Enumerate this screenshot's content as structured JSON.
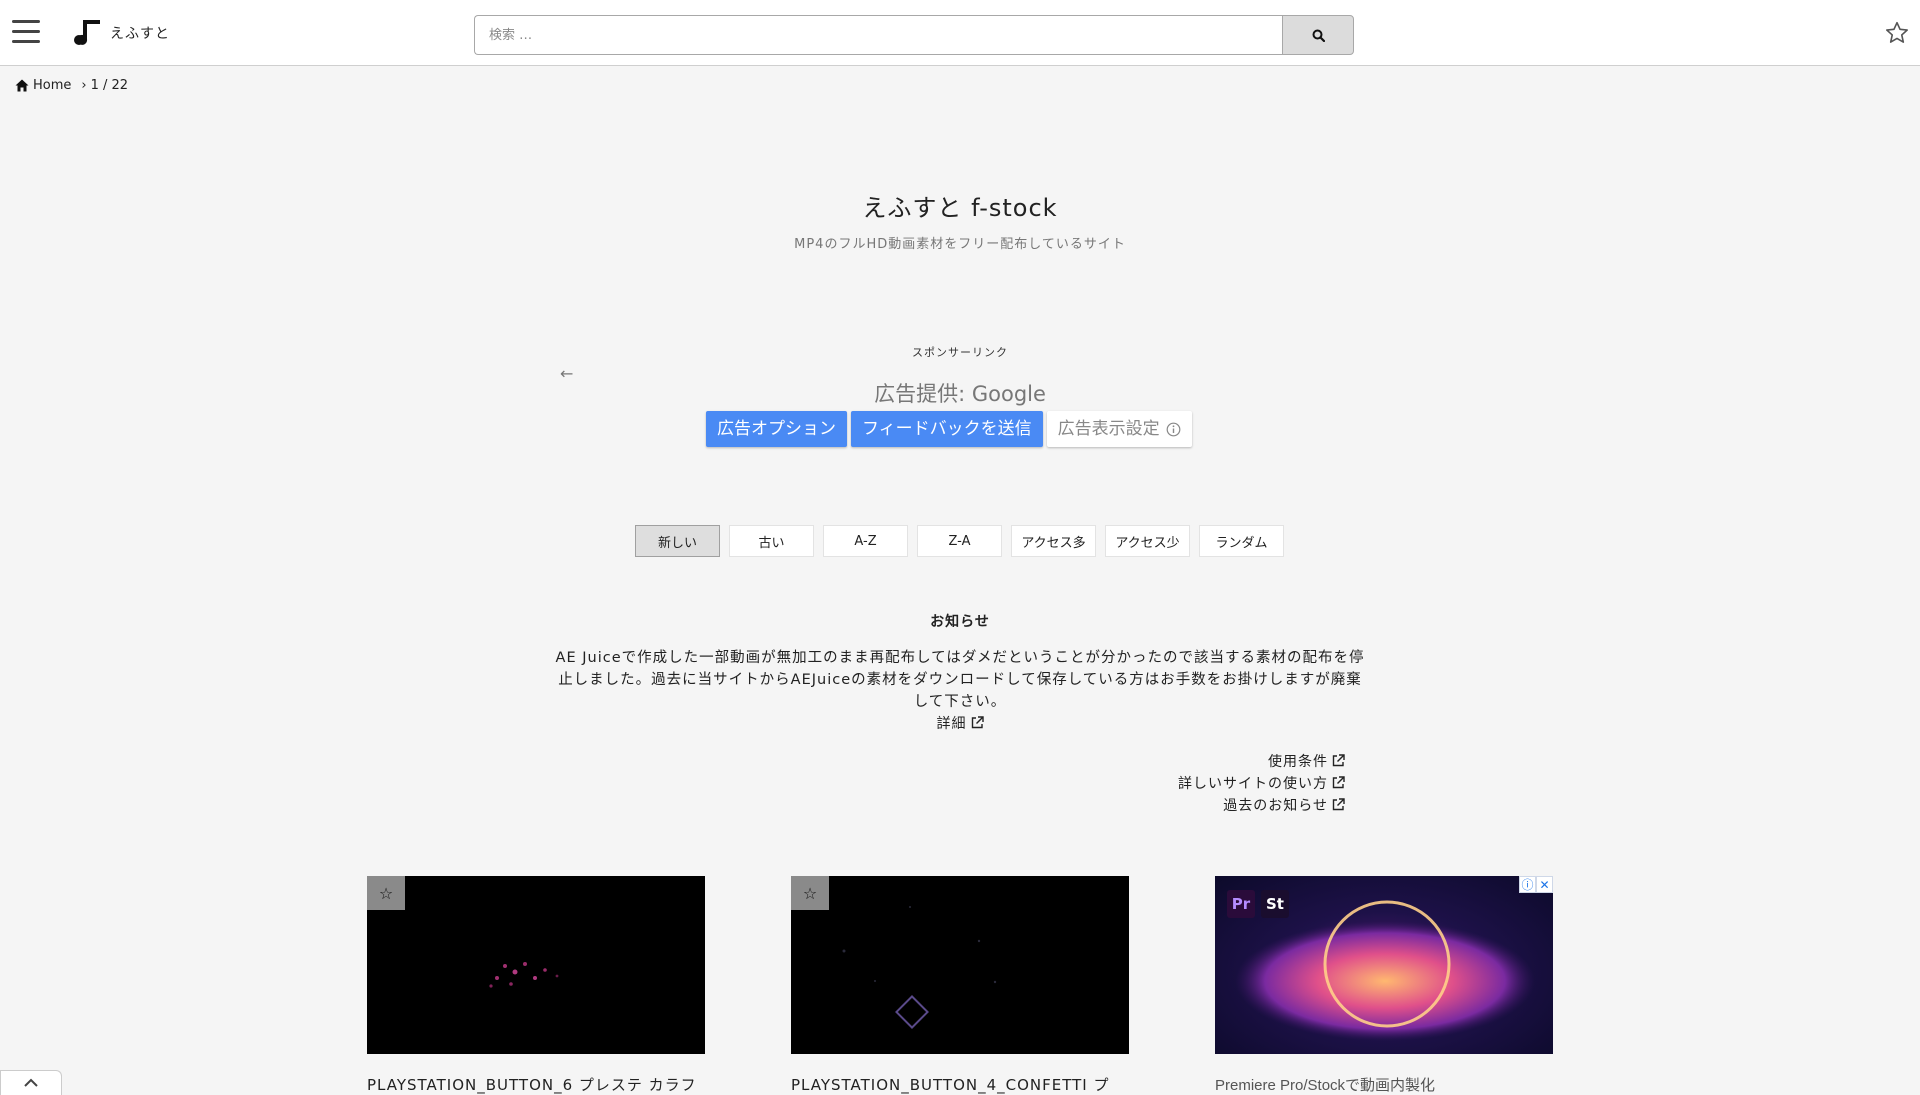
{
  "header": {
    "logo_text": "えふすと",
    "search_placeholder": "検索 …"
  },
  "breadcrumb": {
    "home": "Home",
    "sep": "›",
    "page": "1 / 22"
  },
  "site": {
    "title": "えふすと f-stock",
    "subtitle": "MP4のフルHD動画素材をフリー配布しているサイト"
  },
  "ad": {
    "sponsor_label": "スポンサーリンク",
    "provider": "広告提供: Google",
    "options": "広告オプション",
    "feedback": "フィードバックを送信",
    "settings": "広告表示設定"
  },
  "sorts": [
    "新しい",
    "古い",
    "A-Z",
    "Z-A",
    "アクセス多",
    "アクセス少",
    "ランダム"
  ],
  "sort_active": "新しい",
  "notice": {
    "title": "お知らせ",
    "body": "AE Juiceで作成した一部動画が無加工のまま再配布してはダメだということが分かったので該当する素材の配布を停止しました。過去に当サイトからAEJuiceの素材をダウンロードして保存している方はお手数をお掛けしますが廃棄して下さい。",
    "detail": "詳細"
  },
  "links": {
    "terms": "使用条件",
    "howto": "詳しいサイトの使い方",
    "past": "過去のお知らせ"
  },
  "cards": [
    {
      "title": "PLAYSTATION_BUTTON_6 プレステ カラフ",
      "fav_icon": "☆"
    },
    {
      "title": "PLAYSTATION_BUTTON_4_CONFETTI プ",
      "fav_icon": "☆"
    }
  ],
  "ad_card": {
    "title": "Premiere Pro/Stockで動画内製化",
    "badge_pr": "Pr",
    "badge_st": "St"
  },
  "colors": {
    "ad_blue": "#4a8af4",
    "page_bg": "#f5f5f5"
  }
}
